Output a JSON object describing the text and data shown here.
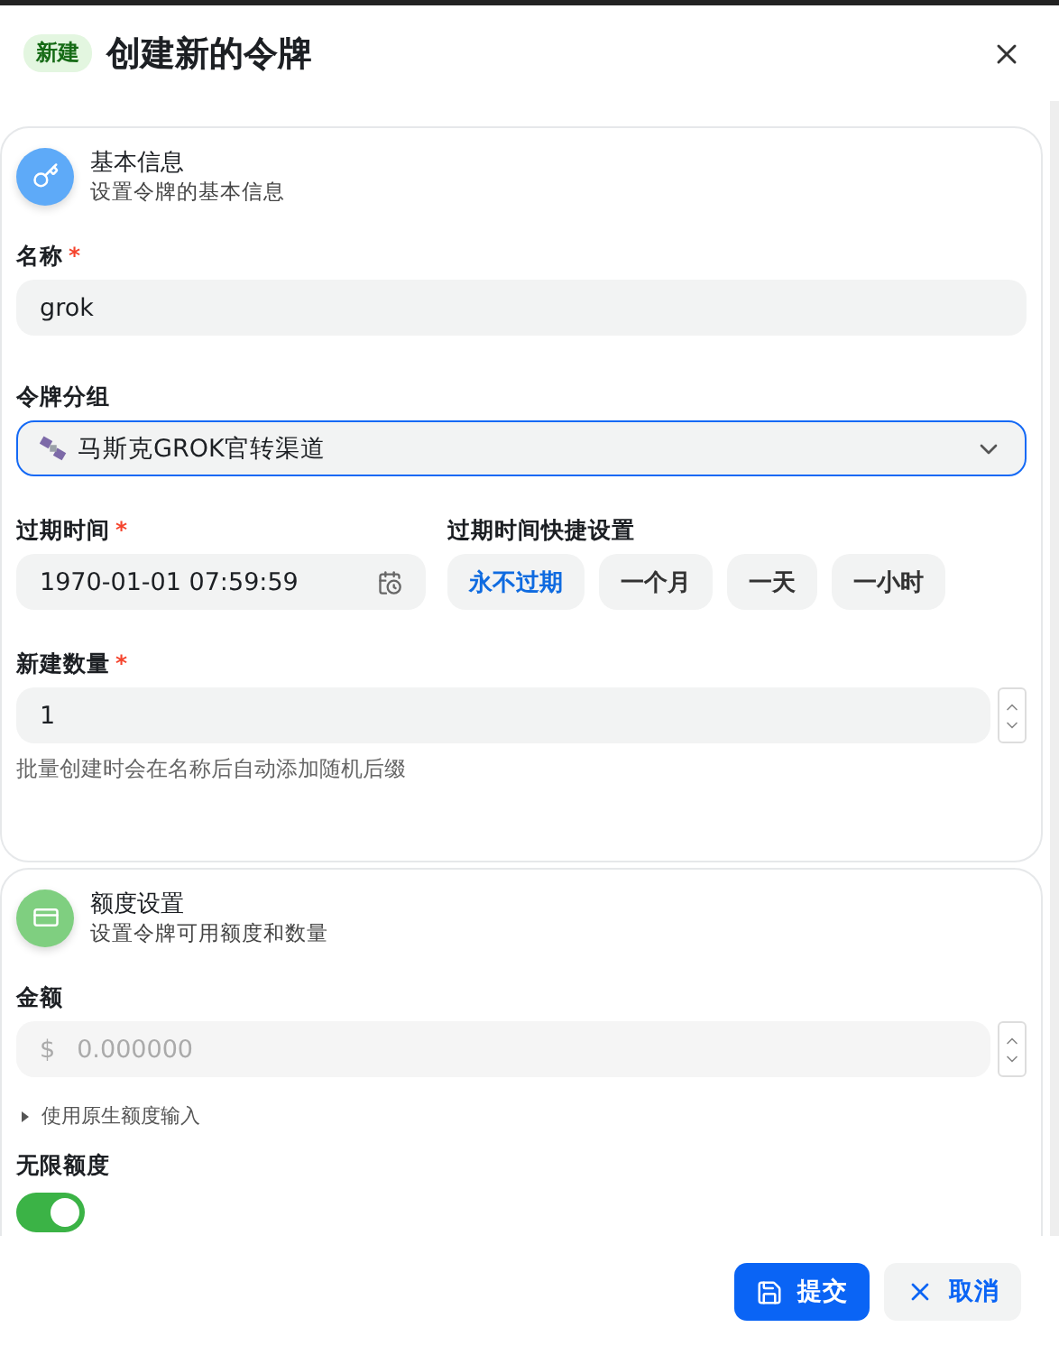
{
  "header": {
    "badge": "新建",
    "title": "创建新的令牌"
  },
  "basic_section": {
    "title": "基本信息",
    "subtitle": "设置令牌的基本信息",
    "name_field": {
      "label": "名称",
      "required_mark": "*",
      "value": "grok"
    },
    "group_field": {
      "label": "令牌分组",
      "value": "马斯克GROK官转渠道",
      "focused": true
    },
    "expire_field": {
      "label": "过期时间",
      "required_mark": "*",
      "value": "1970-01-01 07:59:59"
    },
    "expire_quick": {
      "label": "过期时间快捷设置",
      "options": [
        {
          "label": "永不过期",
          "selected": true
        },
        {
          "label": "一个月",
          "selected": false
        },
        {
          "label": "一天",
          "selected": false
        },
        {
          "label": "一小时",
          "selected": false
        }
      ]
    },
    "count_field": {
      "label": "新建数量",
      "required_mark": "*",
      "value": "1",
      "hint": "批量创建时会在名称后自动添加随机后缀"
    }
  },
  "quota_section": {
    "title": "额度设置",
    "subtitle": "设置令牌可用额度和数量",
    "amount_field": {
      "label": "金额",
      "prefix": "$",
      "value": "0.000000",
      "disabled": true
    },
    "raw_toggle": {
      "label": "使用原生额度输入",
      "expanded": false
    },
    "unlimited": {
      "label": "无限额度",
      "on": true
    }
  },
  "footer": {
    "buttons": [
      {
        "kind": "primary",
        "label": "提交"
      },
      {
        "kind": "secondary",
        "label": "取消"
      }
    ]
  }
}
